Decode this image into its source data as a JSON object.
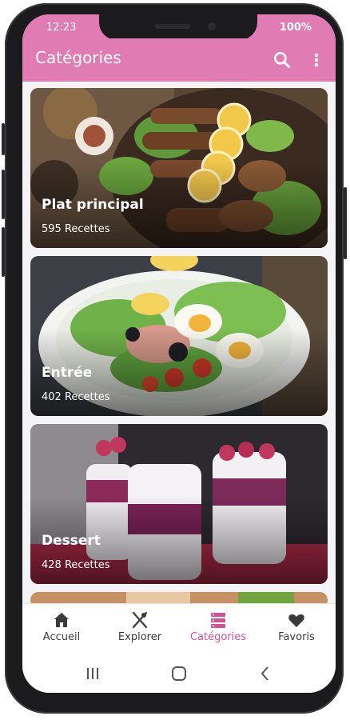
{
  "status_bar": {
    "time": "12:23",
    "battery": "100%"
  },
  "app_bar": {
    "title": "Catégories",
    "search_icon": "search-icon",
    "menu_icon": "more-vert-icon"
  },
  "categories": [
    {
      "name": "Plat principal",
      "count": "595 Recettes"
    },
    {
      "name": "Entrée",
      "count": "402 Recettes"
    },
    {
      "name": "Dessert",
      "count": "428 Recettes"
    }
  ],
  "bottom_nav": [
    {
      "label": "Accueil",
      "icon": "home-icon"
    },
    {
      "label": "Explorer",
      "icon": "utensils-icon"
    },
    {
      "label": "Catégories",
      "icon": "categories-icon"
    },
    {
      "label": "Favoris",
      "icon": "heart-icon"
    }
  ],
  "active_tab": "Catégories",
  "colors": {
    "accent": "#e17bb4",
    "active": "#d1509a"
  }
}
